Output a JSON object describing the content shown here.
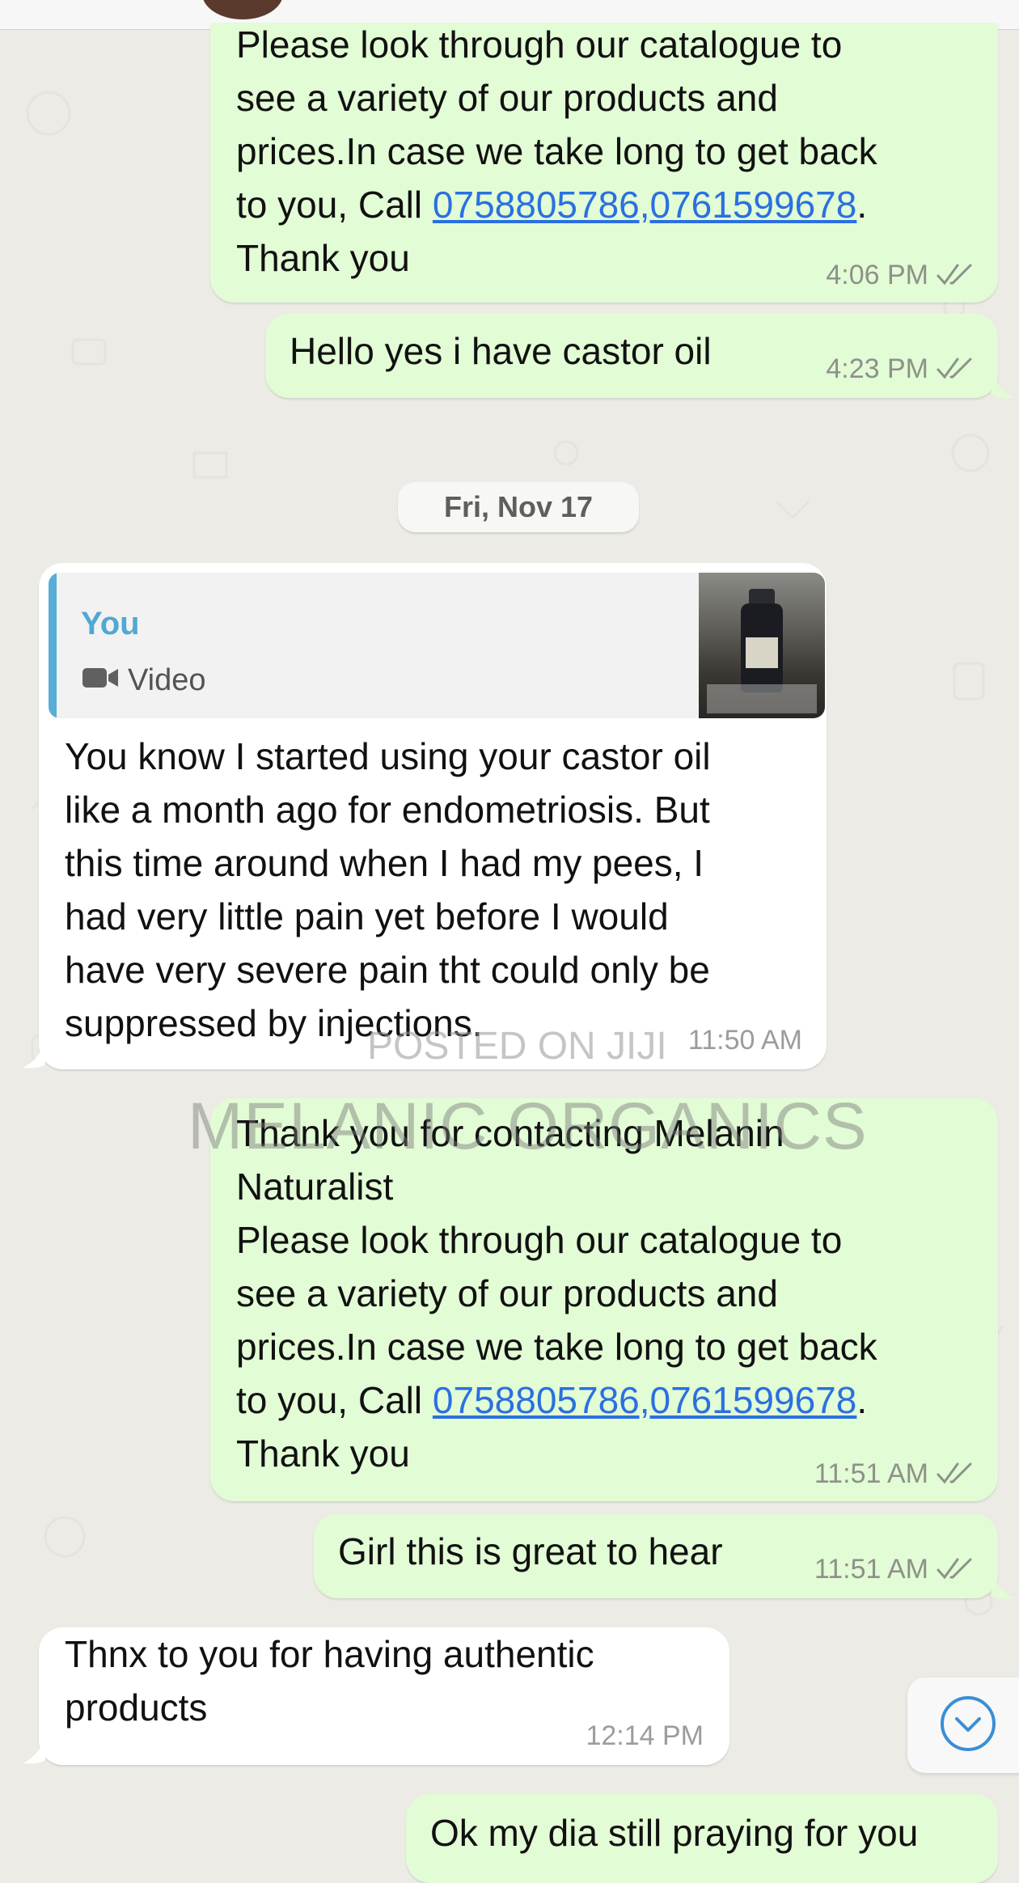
{
  "chat": {
    "messages": [
      {
        "direction": "outgoing",
        "text_before_link": "Please look through our catalogue to\nsee a variety of our products and\nprices.In case we take long to get back\nto you, Call ",
        "link": "0758805786,0761599678",
        "text_after_link": ".\nThank you",
        "time": "4:06 PM",
        "status": "read"
      },
      {
        "direction": "outgoing",
        "text": "Hello yes i have castor oil",
        "time": "4:23 PM",
        "status": "read"
      },
      {
        "direction": "incoming",
        "quote": {
          "author": "You",
          "type": "Video"
        },
        "text": "You know I started using your castor oil\nlike a month ago for endometriosis. But\nthis time around when I had my pees, I\nhad very little pain yet before I would\nhave very severe pain tht could only be\nsuppressed by injections.",
        "time": "11:50 AM"
      },
      {
        "direction": "outgoing",
        "text_before_link": "Thank you for contacting Melanin\nNaturalist\nPlease look through our catalogue to\nsee a variety of our products and\nprices.In case we take long to get back\nto you, Call ",
        "link": "0758805786,0761599678",
        "text_after_link": ".\nThank you",
        "time": "11:51 AM",
        "status": "read"
      },
      {
        "direction": "outgoing",
        "text": "Girl this is great to hear",
        "time": "11:51 AM",
        "status": "read"
      },
      {
        "direction": "incoming",
        "text": "Thnx to you for having authentic\nproducts",
        "time": "12:14 PM"
      },
      {
        "direction": "outgoing",
        "text": "Ok my dia still praying for you"
      }
    ],
    "date_separator": "Fri, Nov 17"
  },
  "watermark": {
    "line1": "POSTED ON JIJI",
    "line2": "MELANIC ORGANICS"
  },
  "icons": {
    "read_receipt": "double-check-icon",
    "video": "video-camera-icon",
    "scroll_down": "chevron-down-circle-icon"
  },
  "colors": {
    "outgoing_bubble": "#e2fcd5",
    "incoming_bubble": "#ffffff",
    "chat_background": "#ecebe6",
    "link": "#2b70e0",
    "quote_accent": "#5aaed6",
    "scroll_button_icon": "#3a8ed6"
  }
}
